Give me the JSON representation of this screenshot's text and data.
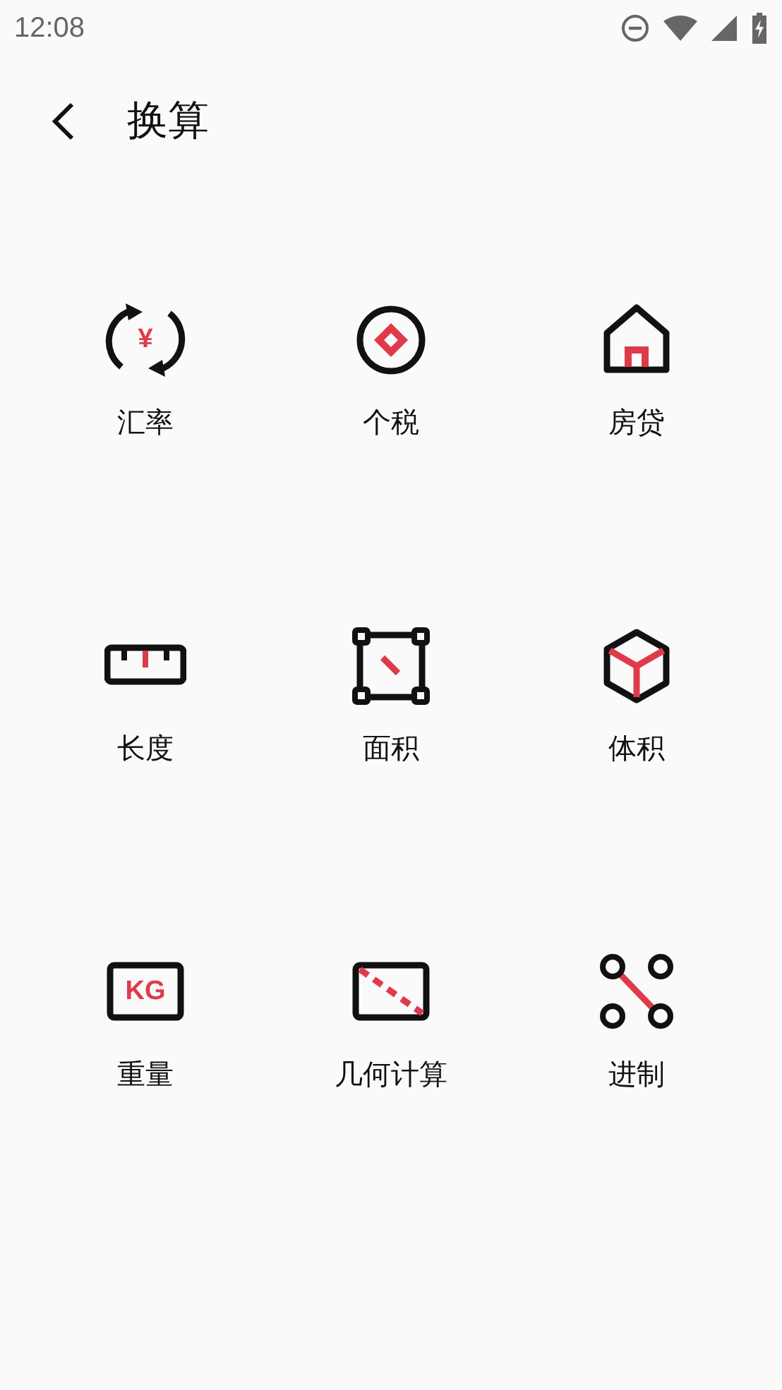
{
  "status_bar": {
    "time": "12:08"
  },
  "header": {
    "title": "换算"
  },
  "tools": [
    {
      "kind": "exchange",
      "label": "汇率",
      "icon_text": "¥"
    },
    {
      "kind": "tax",
      "label": "个税"
    },
    {
      "kind": "house",
      "label": "房贷"
    },
    {
      "kind": "ruler",
      "label": "长度"
    },
    {
      "kind": "area",
      "label": "面积"
    },
    {
      "kind": "cube",
      "label": "体积"
    },
    {
      "kind": "weight",
      "label": "重量",
      "icon_text": "KG"
    },
    {
      "kind": "geometry",
      "label": "几何计算"
    },
    {
      "kind": "base",
      "label": "进制"
    }
  ]
}
